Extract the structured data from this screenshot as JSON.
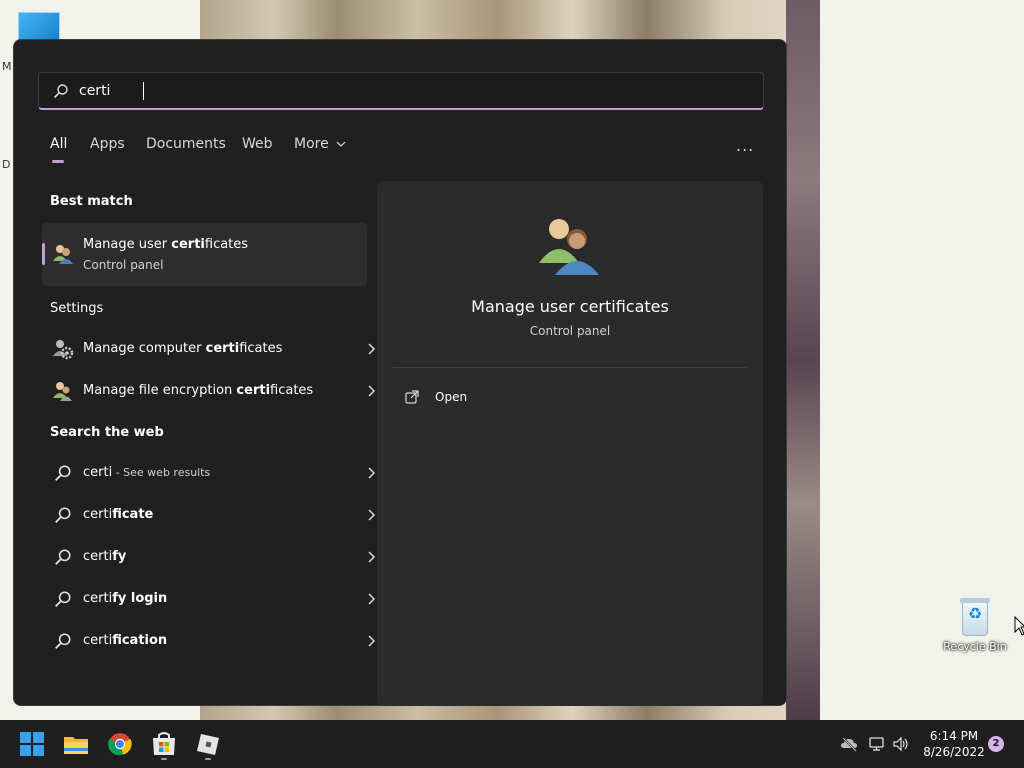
{
  "desktop": {
    "left_letters": [
      "M",
      "D"
    ],
    "recycle_bin_label": "Recycle Bin"
  },
  "search": {
    "value": "certi",
    "placeholder": ""
  },
  "tabs": [
    {
      "label": "All",
      "active": true
    },
    {
      "label": "Apps",
      "active": false
    },
    {
      "label": "Documents",
      "active": false
    },
    {
      "label": "Web",
      "active": false
    },
    {
      "label": "More",
      "active": false
    }
  ],
  "more_options_label": "...",
  "best_match": {
    "section_title": "Best match",
    "title_prefix": "Manage user ",
    "title_bold": "certi",
    "title_suffix": "ficates",
    "subtitle": "Control panel",
    "icon": "users-icon"
  },
  "settings": {
    "section_title": "Settings",
    "items": [
      {
        "prefix": "Manage computer ",
        "bold": "certi",
        "suffix": "ficates",
        "icon": "computer-gear-icon"
      },
      {
        "prefix": "Manage file encryption ",
        "bold": "certi",
        "suffix": "ficates",
        "icon": "users-icon"
      }
    ]
  },
  "web": {
    "section_title": "Search the web",
    "items": [
      {
        "main": "certi",
        "bold": "",
        "note": " - See web results"
      },
      {
        "main": "certi",
        "bold": "ficate",
        "note": ""
      },
      {
        "main": "certi",
        "bold": "fy",
        "note": ""
      },
      {
        "main": "certi",
        "bold": "fy login",
        "note": ""
      },
      {
        "main": "certi",
        "bold": "fication",
        "note": ""
      }
    ]
  },
  "preview": {
    "title": "Manage user certificates",
    "subtitle": "Control panel",
    "open_label": "Open"
  },
  "taskbar": {
    "apps": [
      "windows-start-icon",
      "file-explorer-icon",
      "chrome-icon",
      "microsoft-store-icon",
      "app-icon"
    ],
    "time": "6:14 PM",
    "date": "8/26/2022",
    "notification_count": "2"
  },
  "colors": {
    "accent": "#c79bd6",
    "panel_bg": "#202020",
    "preview_bg": "#2b2b2b",
    "taskbar_bg": "#1f1f1f"
  }
}
